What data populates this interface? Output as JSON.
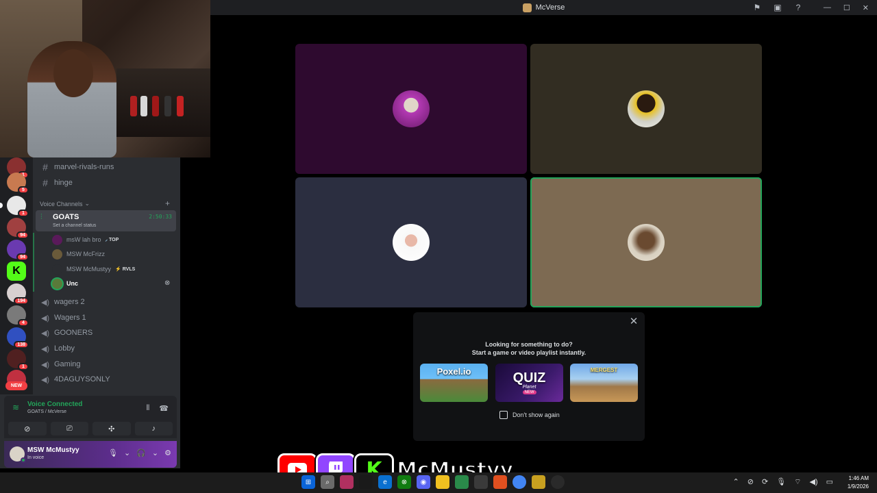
{
  "window": {
    "title": "McVerse",
    "controls": [
      "minimize",
      "maximize",
      "close"
    ]
  },
  "server_rail": {
    "badges": [
      "1",
      "5",
      "1",
      "94",
      "94",
      "194",
      "4",
      "138",
      "1"
    ],
    "new_label": "NEW"
  },
  "channels": {
    "text": [
      {
        "name": "marvel-rivals-runs"
      },
      {
        "name": "hinge"
      }
    ],
    "voice_category": "Voice Channels",
    "active": {
      "name": "GOATS",
      "timer": "2:50:33",
      "status_placeholder": "Set a channel status"
    },
    "members": [
      {
        "name": "msW lah bro",
        "tag": "TOP",
        "tag_color": "#dbdee1"
      },
      {
        "name": "MSW McFrizz",
        "tag": "",
        "tag_color": ""
      },
      {
        "name": "MSW McMustyy",
        "tag": "RVLS",
        "tag_color": "#dbdee1"
      },
      {
        "name": "Unc",
        "tag": "",
        "tag_color": ""
      }
    ],
    "voice": [
      {
        "name": "wagers 2"
      },
      {
        "name": "Wagers 1"
      },
      {
        "name": "GOONERS"
      },
      {
        "name": "Lobby"
      },
      {
        "name": "Gaming"
      },
      {
        "name": "4DAGUYSONLY"
      }
    ]
  },
  "voice_panel": {
    "title": "Voice Connected",
    "subtitle": "GOATS / McVerse"
  },
  "user_panel": {
    "name": "MSW McMustyy",
    "status": "In voice"
  },
  "video_tiles": [
    {
      "bg": "#2e0a2f",
      "speaking": false
    },
    {
      "bg": "#322d22",
      "speaking": false
    },
    {
      "bg": "#2b2e40",
      "speaking": false
    },
    {
      "bg": "#7d6a52",
      "speaking": true
    }
  ],
  "activity_popup": {
    "line1": "Looking for something to do?",
    "line2": "Start a game or video playlist instantly.",
    "games": [
      {
        "title": "Poxel.io"
      },
      {
        "title": "QUIZ",
        "subtitle": "Planet",
        "badge": "NEW"
      },
      {
        "title": "MERGEST"
      }
    ],
    "checkbox_label": "Don't show again"
  },
  "overlay": {
    "handle": "McMustyy"
  },
  "taskbar": {
    "time": "1:46 AM",
    "date": "1/9/2026"
  },
  "colors": {
    "accent_green": "#23a55a",
    "discord_dark": "#1e1f22",
    "youtube_red": "#ff0000",
    "twitch_purple": "#9146ff",
    "kick_green": "#53fc18"
  }
}
